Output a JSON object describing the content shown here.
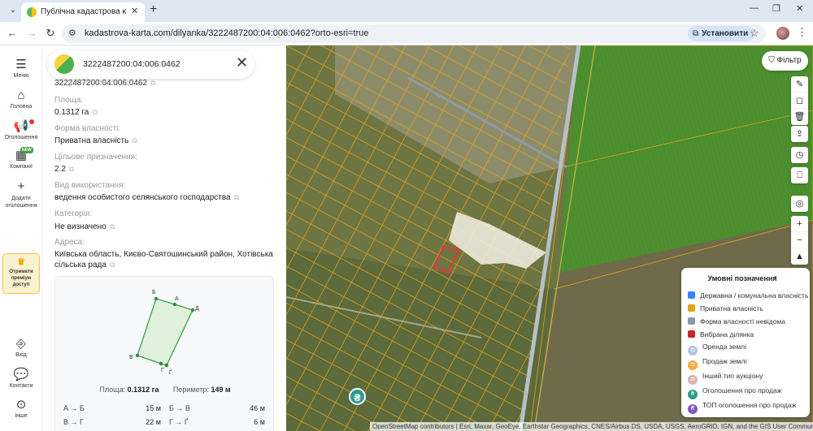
{
  "browser": {
    "tab_title": "Публічна кадастрова карта Ук",
    "tab_close": "✕",
    "new_tab": "+",
    "url": "kadastrova-karta.com/dilyanka/3222487200:04:006:0462?orto-esri=true",
    "install_label": "Установити",
    "minimize": "—",
    "maximize": "❐",
    "close": "✕"
  },
  "rail": {
    "menu": "Меню",
    "home": "Головна",
    "ads": "Оголошення",
    "companies": "Компанії",
    "companies_badge": "NEW",
    "add_ad": "Додати оголошення",
    "premium": "Отримати преміум доступ",
    "login": "Вхід",
    "contacts": "Контакти",
    "other": "Інше"
  },
  "parcel": {
    "cadastral_number": "3222487200:04:006:0462",
    "area_label": "Площа:",
    "area_value": "0.1312 га",
    "ownership_label": "Форма власності:",
    "ownership_value": "Приватна власність",
    "purpose_label": "Цільове призначення:",
    "purpose_value": "2.2",
    "usage_label": "Вид використання:",
    "usage_value": "ведення особистого селянського господарства",
    "category_label": "Категорія:",
    "category_value": "Не визначено",
    "address_label": "Адреса:",
    "address_value": "Київська область, Києво-Святошинський район, Хотівська сільська рада"
  },
  "shape": {
    "vertices": [
      "Б",
      "А",
      "Д",
      "Ґ",
      "Г",
      "В"
    ],
    "area_label": "Площа:",
    "area_value": "0.1312 га",
    "perimeter_label": "Периметр:",
    "perimeter_value": "149 м",
    "segments": [
      {
        "name": "А → Б",
        "length": "15 м"
      },
      {
        "name": "Б → В",
        "length": "46 м"
      },
      {
        "name": "В → Г",
        "length": "22 м"
      },
      {
        "name": "Г → Ґ",
        "length": "6 м"
      }
    ]
  },
  "map": {
    "filter_label": "Фільтр",
    "attribution": "OpenStreetMap contributors | Esri, Maxar, GeoEye, Earthstar Geographics, CNES/Airbus DS, USDA, USGS, AeroGRID, IGN, and the GIS User Community",
    "hryvnia": "₴",
    "legend": {
      "title": "Умовні позначення",
      "items": [
        {
          "label": "Державна / комунальна власність",
          "color": "#3b82f6"
        },
        {
          "label": "Приватна власність",
          "color": "#e0a31a"
        },
        {
          "label": "Форма власності невідома",
          "color": "#8a9bb0"
        },
        {
          "label": "Вибрана ділянка",
          "color": "#c62828"
        },
        {
          "label": "Оренда землі",
          "color": "#b0c4de"
        },
        {
          "label": "Продаж землі",
          "color": "#f4a93b"
        },
        {
          "label": "Інший тип аукціону",
          "color": "#d4b5b0"
        },
        {
          "label": "Оголошення про продаж",
          "color": "#2a9d8f"
        },
        {
          "label": "ТОП оголошення про продаж",
          "color": "#7e57c2"
        }
      ]
    }
  },
  "colors": {
    "parcel_fill": "#dff1dc",
    "parcel_stroke": "#3aa14a",
    "selected": "#e53935",
    "boundary": "#e0a31a"
  }
}
